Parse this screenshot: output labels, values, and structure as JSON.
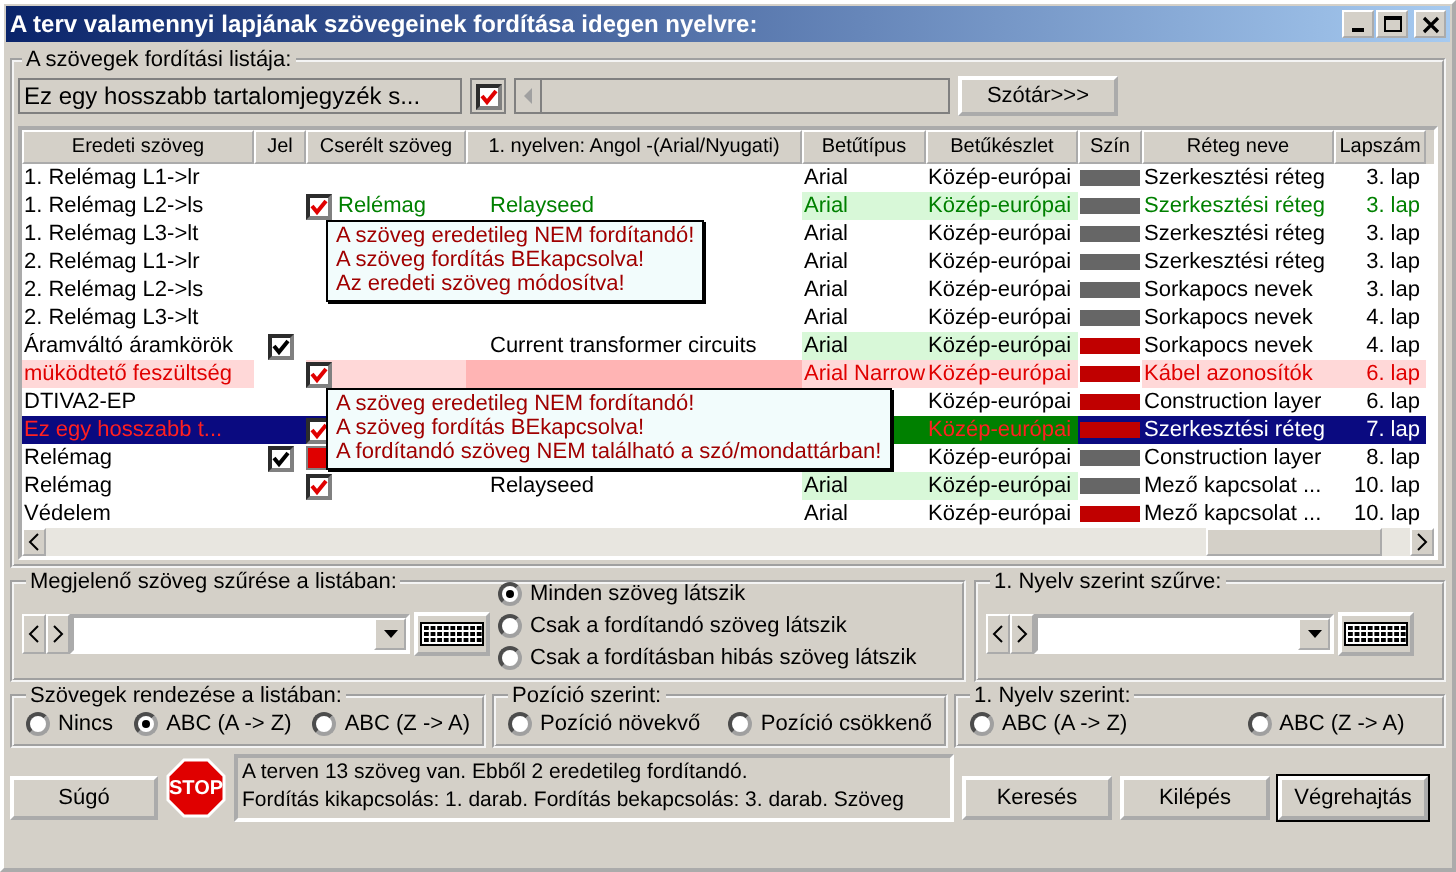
{
  "window": {
    "title": "A terv valamennyi lapjának szövegeinek fordítása idegen nyelvre:"
  },
  "list_group": {
    "label": "A szövegek fordítási listája:",
    "text_field": {
      "value": "Ez egy hosszabb tartalomjegyzék s..."
    },
    "checkbox": {
      "checked": true
    },
    "dictionary_button": "Szótár>>>"
  },
  "table": {
    "columns": [
      "Eredeti szöveg",
      "Jel",
      "Cserélt szöveg",
      "1. nyelven: Angol -(Arial/Nyugati)",
      "Betűtípus",
      "Betűkészlet",
      "Szín",
      "Réteg neve",
      "Lapszám"
    ],
    "rows": [
      {
        "original": "1. Relémag L1->lr",
        "font": "Arial",
        "charset": "Közép-európai",
        "color": "#666666",
        "layer": "Szerkesztési réteg",
        "page": "3. lap",
        "kind": "normal",
        "font_match": false,
        "selected": false
      },
      {
        "original": "1. Relémag L2->ls",
        "toggle": {
          "checked": true
        },
        "replaced": "Relémag",
        "translation": "Relayseed",
        "font": "Arial",
        "charset": "Közép-európai",
        "color": "#666666",
        "layer": "Szerkesztési réteg",
        "page": "3. lap",
        "kind": "new",
        "font_match": true,
        "selected": false,
        "tooltip": [
          "A szöveg eredetileg NEM fordítandó!",
          "A szöveg fordítás BEkapcsolva!",
          "Az eredeti szöveg módosítva!"
        ]
      },
      {
        "original": "1. Relémag L3->lt",
        "font": "Arial",
        "charset": "Közép-európai",
        "color": "#666666",
        "layer": "Szerkesztési réteg",
        "page": "3. lap",
        "kind": "normal",
        "font_match": false,
        "selected": false
      },
      {
        "original": "2. Relémag L1->lr",
        "font": "Arial",
        "charset": "Közép-európai",
        "color": "#666666",
        "layer": "Szerkesztési réteg",
        "page": "3. lap",
        "kind": "normal",
        "font_match": false,
        "selected": false
      },
      {
        "original": "2. Relémag L2->ls",
        "font": "Arial",
        "charset": "Közép-európai",
        "color": "#666666",
        "layer": "Sorkapocs nevek",
        "page": "3. lap",
        "kind": "normal",
        "font_match": false,
        "selected": false
      },
      {
        "original": "2. Relémag L3->lt",
        "font": "Arial",
        "charset": "Közép-európai",
        "color": "#666666",
        "layer": "Sorkapocs nevek",
        "page": "4. lap",
        "kind": "normal",
        "font_match": false,
        "selected": false
      },
      {
        "original": "Áramváltó áramkörök",
        "jel": {
          "checked": true
        },
        "translation": "Current transformer circuits",
        "font": "Arial",
        "charset": "Közép-európai",
        "color": "#c00000",
        "layer": "Sorkapocs nevek",
        "page": "4. lap",
        "kind": "normal",
        "font_match": true,
        "selected": false
      },
      {
        "original": "müködtető feszültség",
        "toggle": {
          "checked": true
        },
        "font": "Arial Narrow",
        "charset": "Közép-európai",
        "color": "#c00000",
        "layer": "Kábel azonosítók",
        "page": "6. lap",
        "kind": "error",
        "font_match": false,
        "selected": false,
        "tooltip": [
          "A szöveg eredetileg NEM fordítandó!",
          "A szöveg fordítás BEkapcsolva!",
          "A fordítandó szöveg NEM található a szó/mondattárban!"
        ]
      },
      {
        "original": "DTIVA2-EP",
        "charset": "Közép-európai",
        "color": "#c00000",
        "layer": "Construction layer",
        "page": "6. lap",
        "kind": "normal",
        "font_match": false,
        "selected": false
      },
      {
        "original": "Ez egy hosszabb t...",
        "toggle": {
          "checked": true
        },
        "charset": "Közép-európai",
        "color": "#c00000",
        "layer": "Szerkesztési réteg",
        "page": "7. lap",
        "kind": "error",
        "font_match": false,
        "selected": true
      },
      {
        "original": "Relémag",
        "jel": {
          "checked": true
        },
        "toggle": {
          "blocked": true
        },
        "charset": "Közép-európai",
        "color": "#666666",
        "layer": "Construction layer",
        "page": "8. lap",
        "kind": "normal",
        "font_match": false,
        "selected": false
      },
      {
        "original": "Relémag",
        "toggle": {
          "checked": true
        },
        "translation": "Relayseed",
        "font": "Arial",
        "charset": "Közép-európai",
        "color": "#666666",
        "layer": "Mező kapcsolat ...",
        "page": "10. lap",
        "kind": "normal",
        "font_match": true,
        "selected": false
      },
      {
        "original": "Védelem",
        "font": "Arial",
        "charset": "Közép-európai",
        "color": "#c00000",
        "layer": "Mező kapcsolat ...",
        "page": "10. lap",
        "kind": "normal",
        "font_match": false,
        "selected": false
      }
    ]
  },
  "filter_group": {
    "label": "Megjelenő szöveg szűrése a listában:",
    "options": [
      {
        "label": "Minden szöveg látszik",
        "selected": true
      },
      {
        "label": "Csak a fordítandó szöveg látszik",
        "selected": false
      },
      {
        "label": "Csak a fordításban hibás szöveg látszik",
        "selected": false
      }
    ]
  },
  "language_filter_group": {
    "label": "1. Nyelv szerint szűrve:"
  },
  "sort_groups": [
    {
      "label": "Szövegek rendezése a listában:",
      "options": [
        {
          "label": "Nincs",
          "selected": false
        },
        {
          "label": "ABC (A -> Z)",
          "selected": true
        },
        {
          "label": "ABC (Z -> A)",
          "selected": false
        }
      ]
    },
    {
      "label": "Pozíció szerint:",
      "options": [
        {
          "label": "Pozíció növekvő",
          "selected": false
        },
        {
          "label": "Pozíció csökkenő",
          "selected": false
        }
      ]
    },
    {
      "label": "1. Nyelv szerint:",
      "options": [
        {
          "label": "ABC (A -> Z)",
          "selected": false
        },
        {
          "label": "ABC (Z -> A)",
          "selected": false
        }
      ]
    }
  ],
  "status": {
    "help_button": "Súgó",
    "stop_sign": "STOP",
    "message": [
      "A terven 13 szöveg van. Ebből 2 eredetileg fordítandó.",
      "Fordítás kikapcsolás: 1. darab. Fordítás bekapcsolás: 3. darab. Szöveg"
    ]
  },
  "buttons": [
    {
      "label": "Keresés",
      "default": false
    },
    {
      "label": "Kilépés",
      "default": false
    },
    {
      "label": "Végrehajtás",
      "default": true
    }
  ]
}
